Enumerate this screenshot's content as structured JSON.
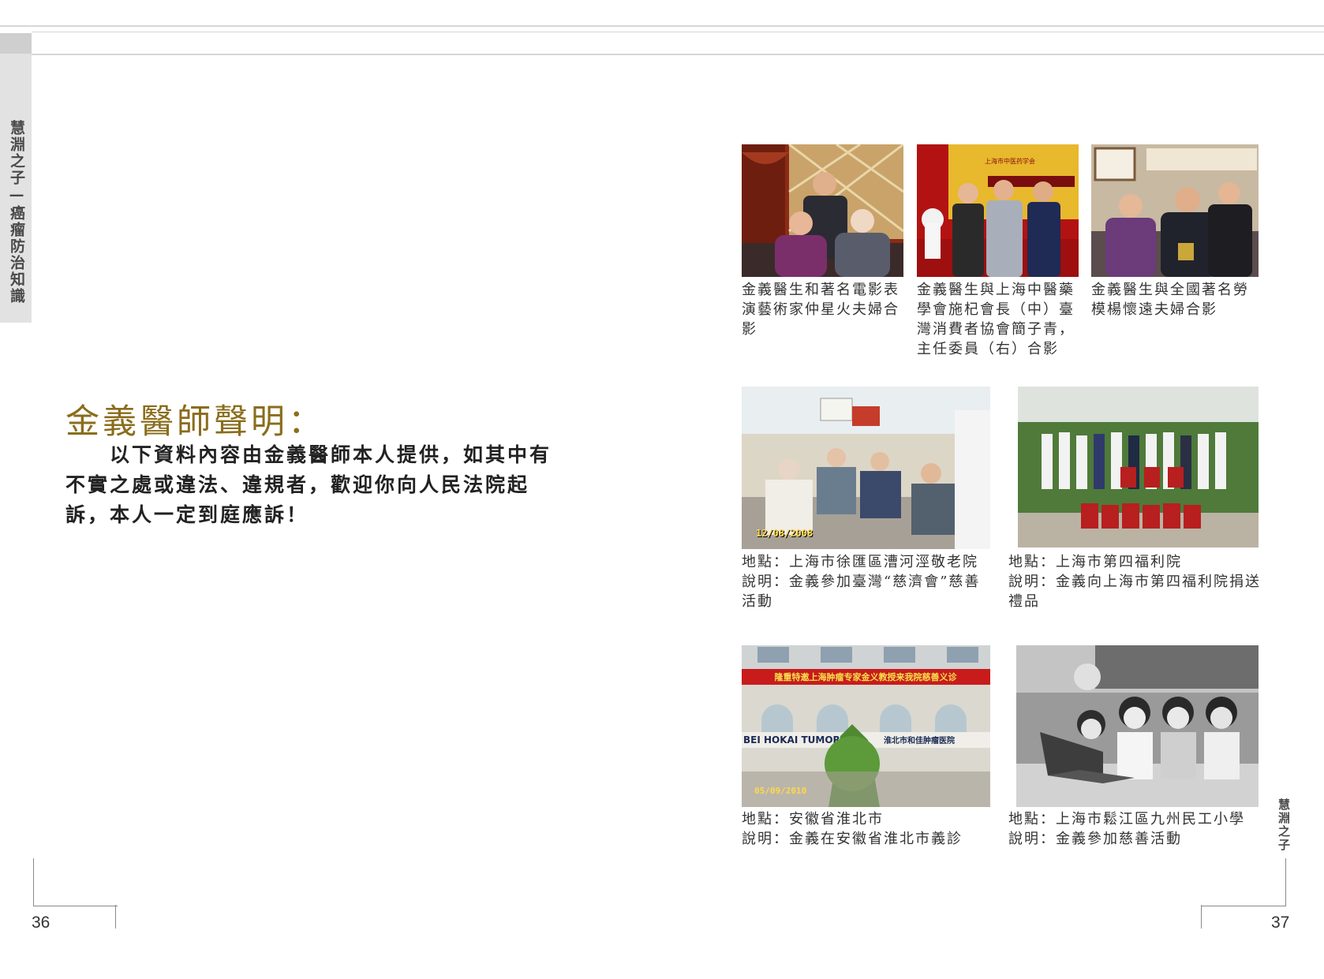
{
  "header": {
    "side_title": "慧淵之子—癌瘤防治知識"
  },
  "left_page": {
    "heading": "金義醫師聲明：",
    "statement": "　　以下資料內容由金義醫師本人提供，如其中有不實之處或違法、違規者，歡迎你向人民法院起訴，本人一定到庭應訴！",
    "page_number": "36"
  },
  "right_page": {
    "side_title": "慧淵之子",
    "page_number": "37",
    "photos_row1": [
      {
        "caption": "金義醫生和著名電影表演藝術家仲星火夫婦合影"
      },
      {
        "caption": "金義醫生與上海中醫藥學會施杞會長（中）臺灣消費者協會簡子青，主任委員（右）合影",
        "banner": "上海市中医药学会"
      },
      {
        "caption": "金義醫生與全國著名勞模楊懷遠夫婦合影"
      }
    ],
    "photos_row2": [
      {
        "location": "地點：上海市徐匯區漕河涇敬老院",
        "description": "說明：金義參加臺灣“慈濟會”慈善活動",
        "stamp": "12/08/2008"
      },
      {
        "location": "地點：上海市第四福利院",
        "description": "說明：金義向上海市第四福利院捐送禮品"
      }
    ],
    "photos_row3": [
      {
        "location": "地點：安徽省淮北市",
        "description": "說明：金義在安徽省淮北市義診",
        "stamp": "05/09/2010",
        "banner": "隆重特邀上海肿瘤专家金义教授来我院慈善义诊",
        "sign_left": "BEI HOKAI TUMOR",
        "sign_right": "淮北市和佳肿瘤医院"
      },
      {
        "location": "地點：上海市鬆江區九州民工小學",
        "description": "說明：金義參加慈善活動"
      }
    ]
  },
  "colors": {
    "heading": "#8a6d1c",
    "side_tab": "#e2e2e2",
    "rule": "#d6d6d6"
  }
}
